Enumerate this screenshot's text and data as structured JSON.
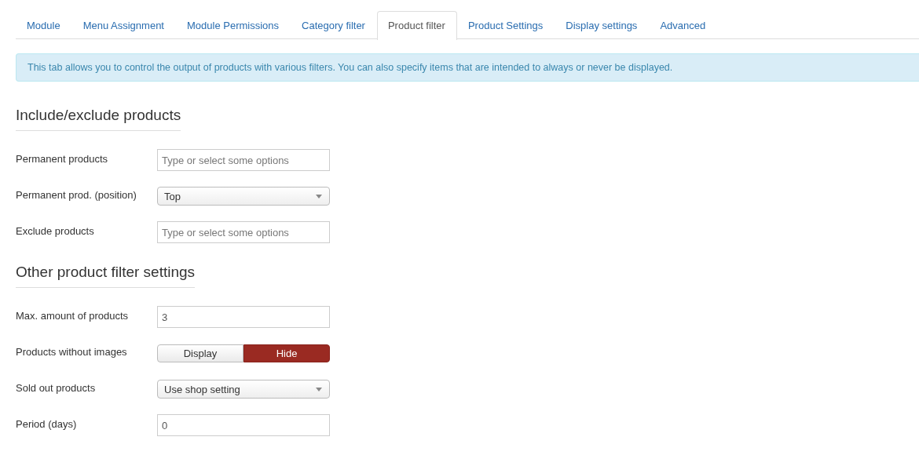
{
  "tabs": [
    {
      "label": "Module",
      "selected": false
    },
    {
      "label": "Menu Assignment",
      "selected": false
    },
    {
      "label": "Module Permissions",
      "selected": false
    },
    {
      "label": "Category filter",
      "selected": false
    },
    {
      "label": "Product filter",
      "selected": true
    },
    {
      "label": "Product Settings",
      "selected": false
    },
    {
      "label": "Display settings",
      "selected": false
    },
    {
      "label": "Advanced",
      "selected": false
    }
  ],
  "alert": "This tab allows you to control the output of products with various filters. You can also specify items that are intended to always or never be displayed.",
  "sections": [
    {
      "title": "Include/exclude products",
      "fields": [
        {
          "kind": "text",
          "label": "Permanent products",
          "placeholder": "Type or select some options"
        },
        {
          "kind": "select",
          "label": "Permanent prod. (position)",
          "value": "Top"
        },
        {
          "kind": "text",
          "label": "Exclude products",
          "placeholder": "Type or select some options"
        }
      ]
    },
    {
      "title": "Other product filter settings",
      "fields": [
        {
          "kind": "text",
          "label": "Max. amount of products",
          "value": "3"
        },
        {
          "kind": "toggle",
          "label": "Products without images",
          "options": [
            {
              "label": "Display",
              "selected": false
            },
            {
              "label": "Hide",
              "selected": true
            }
          ]
        },
        {
          "kind": "select",
          "label": "Sold out products",
          "value": "Use shop setting"
        },
        {
          "kind": "text",
          "label": "Period (days)",
          "value": "0"
        }
      ]
    }
  ]
}
